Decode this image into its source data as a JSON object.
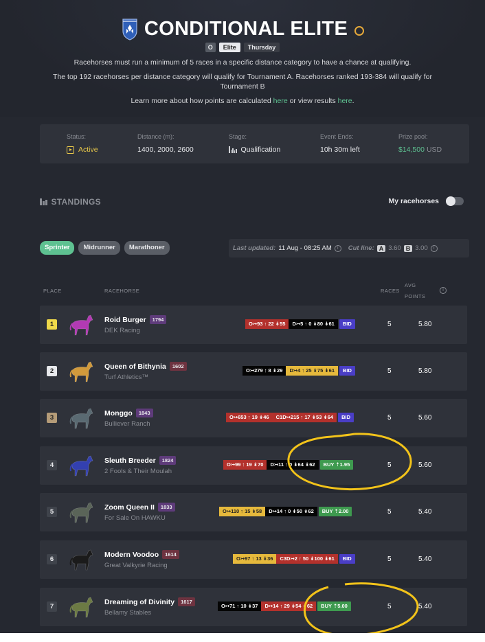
{
  "hero": {
    "title": "CONDITIONAL ELITE",
    "tags": [
      "O",
      "Elite",
      "Thursday"
    ],
    "line1": "Racehorses must run a minimum of 5 races in a specific distance category to have a chance at qualifying.",
    "line2a": "The top 192 racehorses per distance category will qualify for Tournament A. Racehorses ranked 193-384 will qualify for",
    "line2b": "Tournament B",
    "learn_prefix": "Learn more about how points are calculated",
    "link_here1": "here",
    "learn_mid": "or view results",
    "link_here2": "here",
    "learn_suffix": "."
  },
  "status": {
    "status_label": "Status:",
    "status_value": "Active",
    "distance_label": "Distance (m):",
    "distance_value": "1400, 2000, 2600",
    "stage_label": "Stage:",
    "stage_value": "Qualification",
    "ends_label": "Event Ends:",
    "ends_value": "10h 30m left",
    "prize_label": "Prize pool:",
    "prize_value": "$14,500",
    "prize_currency": "USD"
  },
  "standings": {
    "title": "STANDINGS",
    "my_racehorses": "My racehorses",
    "categories": [
      "Sprinter",
      "Midrunner",
      "Marathoner"
    ],
    "updated_label": "Last updated:",
    "updated_value": "11 Aug - 08:25 AM",
    "cutline_label": "Cut line:",
    "cut_a": "A",
    "cut_a_val": "3.60",
    "cut_b": "B",
    "cut_b_val": "3.00"
  },
  "table": {
    "headers": {
      "place": "PLACE",
      "racehorse": "RACEHORSE",
      "races": "RACES",
      "avg1": "AVG",
      "avg2": "POINTS"
    },
    "rows": [
      {
        "place": "1",
        "name": "Roid Burger",
        "rating": "1794",
        "stable": "DEK Racing",
        "chips": [
          "O↣93 ↑ 22 ↡55",
          "D↣5 ↑ 0 ↡80 ↡61"
        ],
        "action": "BID",
        "races": "5",
        "avg": "5.80"
      },
      {
        "place": "2",
        "name": "Queen of Bithynia",
        "rating": "1602",
        "stable": "Turf Athletics™",
        "chips": [
          "O↣279 ↑ 8 ↡29",
          "D↣4 ↑ 25 ↡75 ↡61"
        ],
        "action": "BID",
        "races": "5",
        "avg": "5.80"
      },
      {
        "place": "3",
        "name": "Monggo",
        "rating": "1843",
        "stable": "Bulliever Ranch",
        "chips": [
          "O↣653 ↑ 19 ↡46",
          "C1D↣215 ↑ 17 ↡53 ↡64"
        ],
        "action": "BID",
        "races": "5",
        "avg": "5.60"
      },
      {
        "place": "4",
        "name": "Sleuth Breeder",
        "rating": "1824",
        "stable": "2 Fools & Their Moulah",
        "chips": [
          "O↣99 ↑ 19 ↡70",
          "D↣11 ↑ 0 ↡64 ↡62"
        ],
        "action": "BUY ⇡1.95",
        "races": "5",
        "avg": "5.60"
      },
      {
        "place": "5",
        "name": "Zoom Queen II",
        "rating": "1833",
        "stable": "For Sale On HAWKU",
        "chips": [
          "O↣110 ↑ 15 ↡58",
          "D↣14 ↑ 0 ↡50 ↡62"
        ],
        "action": "BUY ⇡2.00",
        "races": "5",
        "avg": "5.40"
      },
      {
        "place": "6",
        "name": "Modern Voodoo",
        "rating": "1614",
        "stable": "Great Valkyrie Racing",
        "chips": [
          "O↣97 ↑ 13 ↡36",
          "C3D↣2 ↑ 50 ↡100 ↡61"
        ],
        "action": "BID",
        "races": "5",
        "avg": "5.40"
      },
      {
        "place": "7",
        "name": "Dreaming of Divinity",
        "rating": "1617",
        "stable": "Bellamy Stables",
        "chips": [
          "O↣71 ↑ 10 ↡37",
          "D↣14 ↑ 29 ↡54 ↡62"
        ],
        "action": "BUY ⇡5.00",
        "races": "5",
        "avg": "5.40"
      }
    ]
  },
  "colors": {
    "accent_green": "#5ec191",
    "bid_purple": "#4a3ec6",
    "buy_green": "#3e9a4f",
    "annotation_yellow": "#f2c31a",
    "horse_colors": [
      "#b23ab3",
      "#d19a3c",
      "#5a6a72",
      "#3340b0",
      "#5a6458",
      "#1b1b1b",
      "#6c7a44"
    ]
  }
}
